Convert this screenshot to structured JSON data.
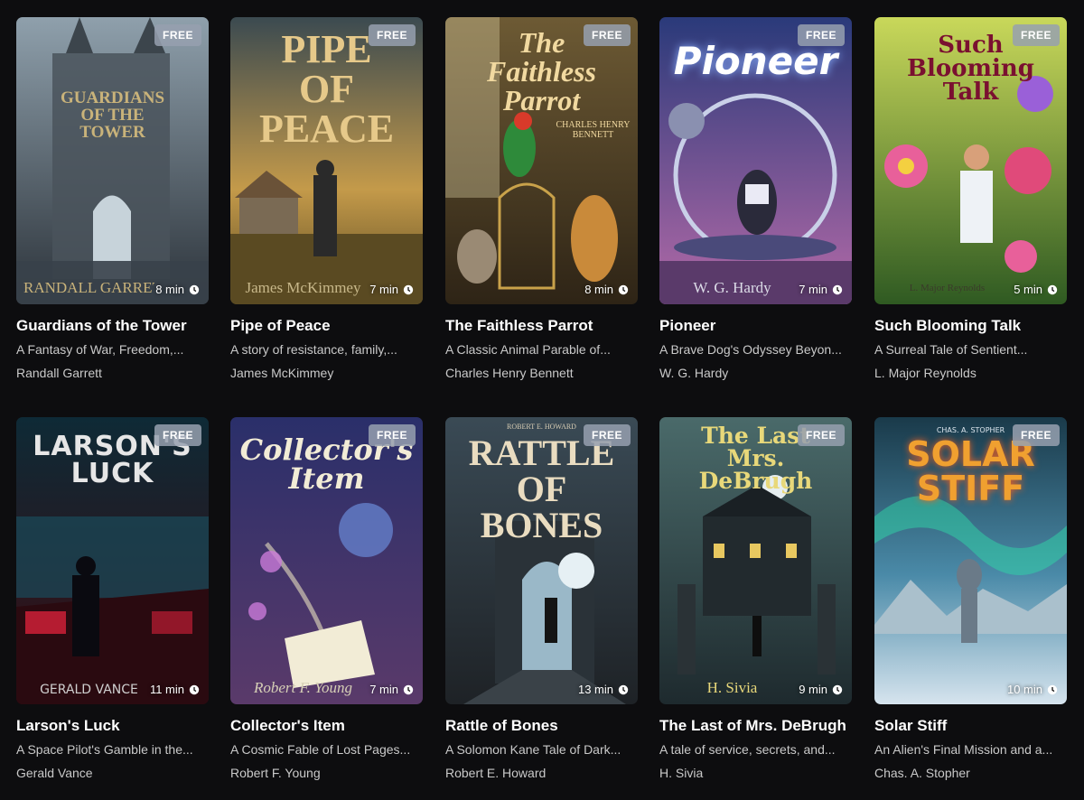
{
  "badge_label": "FREE",
  "books": [
    {
      "title": "Guardians of the Tower",
      "description": "A Fantasy of War, Freedom,...",
      "author": "Randall Garrett",
      "duration": "8 min",
      "cover_title": "GUARDIANS\nOF THE\nTOWER",
      "cover_author": "RANDALL GARRETT",
      "colors": {
        "top": "#8fa0ac",
        "bottom": "#2c333a",
        "accent": "#c9b37a"
      }
    },
    {
      "title": "Pipe of Peace",
      "description": "A story of resistance, family,...",
      "author": "James McKimmey",
      "duration": "7 min",
      "cover_title": "PIPE\nOF\nPEACE",
      "cover_author": "James McKimmey",
      "colors": {
        "top": "#3b4a50",
        "bottom": "#5a4a22",
        "accent": "#e6c98a"
      }
    },
    {
      "title": "The Faithless Parrot",
      "description": "A Classic Animal Parable of...",
      "author": "Charles Henry Bennett",
      "duration": "8 min",
      "cover_title": "The\nFaithless\nParrot",
      "cover_author": "CHARLES HENRY BENNETT",
      "colors": {
        "top": "#6d5a34",
        "bottom": "#2e2416",
        "accent": "#f1d9a0"
      }
    },
    {
      "title": "Pioneer",
      "description": "A Brave Dog's Odyssey Beyon...",
      "author": "W. G. Hardy",
      "duration": "7 min",
      "cover_title": "Pioneer",
      "cover_author": "W. G. Hardy",
      "colors": {
        "top": "#2a3a7a",
        "bottom": "#b46aa8",
        "accent": "#ffffff"
      }
    },
    {
      "title": "Such Blooming Talk",
      "description": "A Surreal Tale of Sentient...",
      "author": "L. Major Reynolds",
      "duration": "5 min",
      "cover_title": "Such\nBlooming\nTalk",
      "cover_author": "L. Major Reynolds",
      "colors": {
        "top": "#c9d85a",
        "bottom": "#2f5a22",
        "accent": "#7a1030"
      }
    },
    {
      "title": "Larson's Luck",
      "description": "A Space Pilot's Gamble in the...",
      "author": "Gerald Vance",
      "duration": "11 min",
      "cover_title": "LARSON'S\nLUCK",
      "cover_author": "GERALD VANCE",
      "colors": {
        "top": "#0e2a36",
        "bottom": "#3a0a10",
        "accent": "#e6e6e6"
      }
    },
    {
      "title": "Collector's Item",
      "description": "A Cosmic Fable of Lost Pages...",
      "author": "Robert F. Young",
      "duration": "7 min",
      "cover_title": "Collector's\nItem",
      "cover_author": "Robert F. Young",
      "colors": {
        "top": "#2a2f6a",
        "bottom": "#5a3a6a",
        "accent": "#f2ecd6"
      }
    },
    {
      "title": "Rattle of Bones",
      "description": "A Solomon Kane Tale of Dark...",
      "author": "Robert E. Howard",
      "duration": "13 min",
      "cover_title": "RATTLE\nOF BONES",
      "cover_author": "ROBERT E. HOWARD",
      "colors": {
        "top": "#3a4a55",
        "bottom": "#1e2226",
        "accent": "#e9dcc0"
      }
    },
    {
      "title": "The Last of Mrs. DeBrugh",
      "description": "A tale of service, secrets, and...",
      "author": "H. Sivia",
      "duration": "9 min",
      "cover_title": "The Last\nMrs. DeBrugh",
      "cover_author": "H. Sivia",
      "colors": {
        "top": "#4a6a6a",
        "bottom": "#1e2a2e",
        "accent": "#e8d87a"
      }
    },
    {
      "title": "Solar Stiff",
      "description": "An Alien's Final Mission and a...",
      "author": "Chas. A. Stopher",
      "duration": "10 min",
      "cover_title": "SOLAR\nSTIFF",
      "cover_author": "CHAS. A. STOPHER",
      "colors": {
        "top": "#1a3a4a",
        "bottom": "#d6e4ee",
        "accent": "#f0a030"
      }
    }
  ]
}
